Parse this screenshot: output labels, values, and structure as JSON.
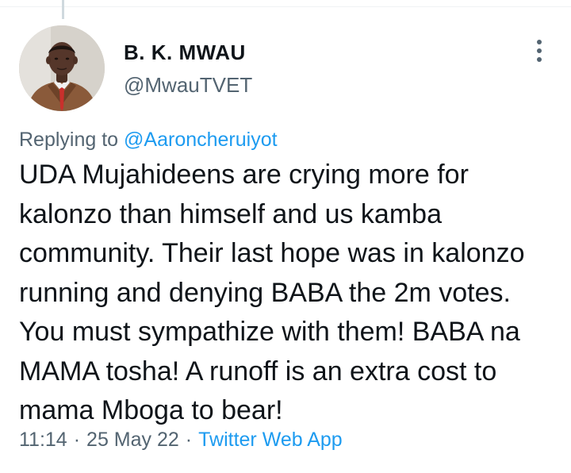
{
  "tweet": {
    "author_name": "B. K. MWAU",
    "author_handle": "@MwauTVET",
    "reply_prefix": "Replying to",
    "reply_mention": "@Aaroncheruiyot",
    "text": "UDA Mujahideens are crying more for kalonzo than himself and us kamba community. Their last hope was in kalonzo running and denying BABA the 2m votes. You must sympathize with them! BABA na MAMA tosha! A runoff is an extra cost to mama Mboga to bear!",
    "time": "11:14",
    "separator": "·",
    "date": "25 May 22",
    "source": "Twitter Web App"
  },
  "icons": {
    "more": "more-vertical-icon",
    "avatar": "profile-photo"
  },
  "colors": {
    "text_primary": "#0f1419",
    "text_secondary": "#536471",
    "link": "#1d9bf0",
    "divider": "#eff3f4"
  }
}
